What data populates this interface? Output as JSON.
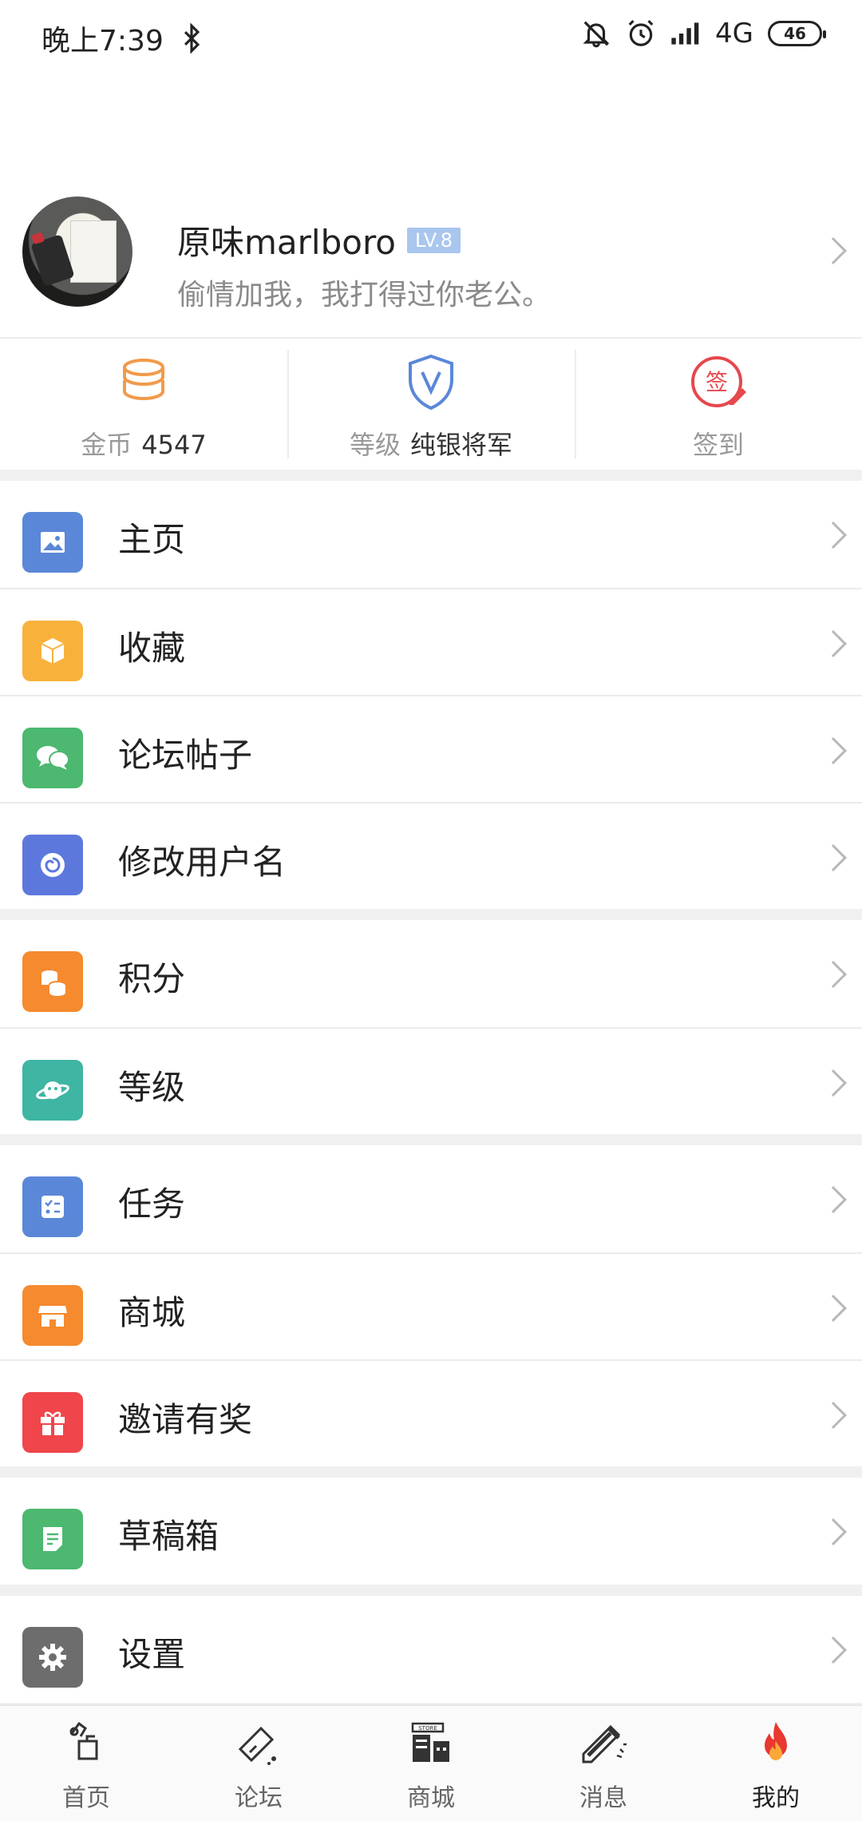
{
  "status_bar": {
    "time": "晚上7:39",
    "network": "4G",
    "battery": "46",
    "icons": [
      "bluetooth-icon",
      "mute-icon",
      "alarm-icon",
      "signal-icon"
    ]
  },
  "profile": {
    "username": "原味marlboro",
    "level_badge": "LV.8",
    "signature": "偷情加我，我打得过你老公。"
  },
  "stats": [
    {
      "label": "金币",
      "value": "4547",
      "icon": "coins-icon",
      "color": "#f29a4a"
    },
    {
      "label": "等级",
      "value": "纯银将军",
      "icon": "shield-v-icon",
      "color": "#5b87d8"
    },
    {
      "label": "签到",
      "value": "",
      "icon": "sign-in-icon",
      "color": "#e5484d"
    }
  ],
  "menu_groups": [
    [
      {
        "label": "主页",
        "icon": "image-icon",
        "color": "#5b87d8"
      },
      {
        "label": "收藏",
        "icon": "box-icon",
        "color": "#f8b23c"
      },
      {
        "label": "论坛帖子",
        "icon": "chat-icon",
        "color": "#4cb870"
      },
      {
        "label": "修改用户名",
        "icon": "spiral-icon",
        "color": "#5d78dd"
      }
    ],
    [
      {
        "label": "积分",
        "icon": "coins-stack-icon",
        "color": "#f58a2e"
      },
      {
        "label": "等级",
        "icon": "planet-icon",
        "color": "#3fb5a4"
      }
    ],
    [
      {
        "label": "任务",
        "icon": "task-list-icon",
        "color": "#5b87d8"
      },
      {
        "label": "商城",
        "icon": "shop-icon",
        "color": "#f58a2e"
      },
      {
        "label": "邀请有奖",
        "icon": "gift-icon",
        "color": "#f0454b"
      }
    ],
    [
      {
        "label": "草稿箱",
        "icon": "draft-icon",
        "color": "#4cb870"
      }
    ],
    [
      {
        "label": "设置",
        "icon": "gear-icon",
        "color": "#6d6d6d"
      }
    ]
  ],
  "bottom_nav": [
    {
      "label": "首页",
      "icon": "home-icon"
    },
    {
      "label": "论坛",
      "icon": "forum-icon"
    },
    {
      "label": "商城",
      "icon": "store-icon"
    },
    {
      "label": "消息",
      "icon": "message-icon"
    },
    {
      "label": "我的",
      "icon": "flame-icon",
      "active": true
    }
  ]
}
